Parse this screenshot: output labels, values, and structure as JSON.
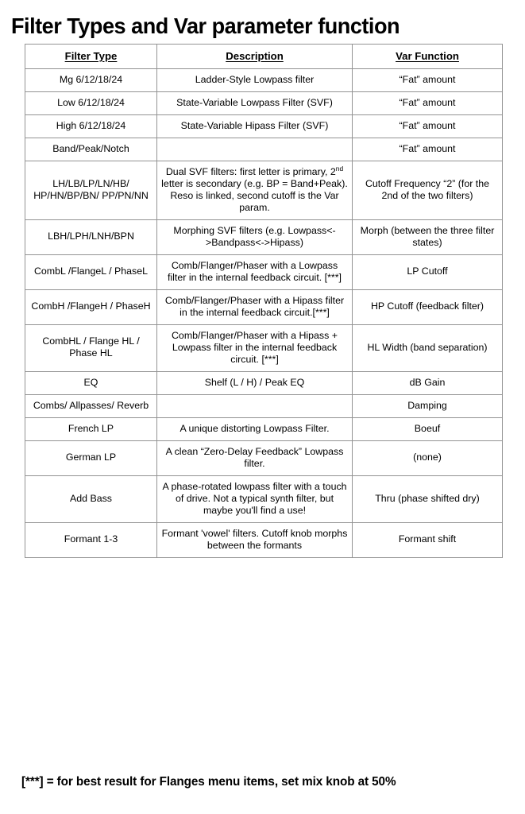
{
  "document": {
    "title": "Filter Types and Var parameter function",
    "footnote": "[***] = for best result for Flanges menu items, set mix knob at 50%"
  },
  "table": {
    "headers": {
      "filter_type": "Filter Type",
      "description": "Description",
      "var_function": "Var Function "
    },
    "rows": [
      {
        "type": "Mg 6/12/18/24",
        "description": "Ladder-Style Lowpass filter",
        "var": "“Fat” amount"
      },
      {
        "type": "Low 6/12/18/24",
        "description": "State-Variable Lowpass Filter (SVF)",
        "var": "“Fat” amount"
      },
      {
        "type": "High 6/12/18/24",
        "description": "State-Variable Hipass Filter (SVF)",
        "var": "“Fat” amount"
      },
      {
        "type": "Band/Peak/Notch",
        "description": "",
        "var": "“Fat” amount"
      },
      {
        "type": "LH/LB/LP/LN/HB/ HP/HN/BP/BN/ PP/PN/NN",
        "description_pre": "Dual SVF filters:  first letter is primary, 2",
        "description_sup": "nd",
        "description_post": " letter is secondary (e.g. BP = Band+Peak).  Reso is linked, second cutoff is the Var param.",
        "var": "Cutoff Frequency “2” (for the 2nd of the two filters)"
      },
      {
        "type": "LBH/LPH/LNH/BPN",
        "description": "Morphing SVF filters (e.g. Lowpass<->Bandpass<->Hipass)",
        "var": "Morph (between the three filter states)"
      },
      {
        "type": "CombL /FlangeL / PhaseL",
        "description": "Comb/Flanger/Phaser with a Lowpass filter in the internal feedback circuit. [***]",
        "var": "LP Cutoff"
      },
      {
        "type": "CombH /FlangeH / PhaseH",
        "description": "Comb/Flanger/Phaser with a Hipass filter in the internal feedback circuit.[***]",
        "var": "HP Cutoff (feedback filter)"
      },
      {
        "type": "CombHL / Flange HL / Phase HL",
        "description": "Comb/Flanger/Phaser with a Hipass + Lowpass filter in the internal feedback circuit. [***]",
        "var": "HL Width (band separation)"
      },
      {
        "type": "EQ",
        "description": "Shelf (L / H) / Peak EQ",
        "var": "dB Gain"
      },
      {
        "type": "Combs/ Allpasses/ Reverb",
        "description": "",
        "var": "Damping"
      },
      {
        "type": "French LP",
        "description": "A unique distorting Lowpass Filter.",
        "var": "Boeuf"
      },
      {
        "type": "German LP",
        "description": "A clean “Zero-Delay Feedback” Lowpass filter.",
        "var": "(none)"
      },
      {
        "type": "Add Bass",
        "description": "A phase-rotated lowpass filter with a touch of drive.  Not a typical synth filter, but maybe you'll find a use!",
        "var": "Thru (phase shifted dry)"
      },
      {
        "type": "Formant 1-3",
        "description": "Formant 'vowel' filters.  Cutoff knob morphs between the formants",
        "var": "Formant shift"
      }
    ]
  },
  "colors": {
    "page_background": "#ffffff",
    "text": "#000000",
    "table_border": "#939393"
  }
}
